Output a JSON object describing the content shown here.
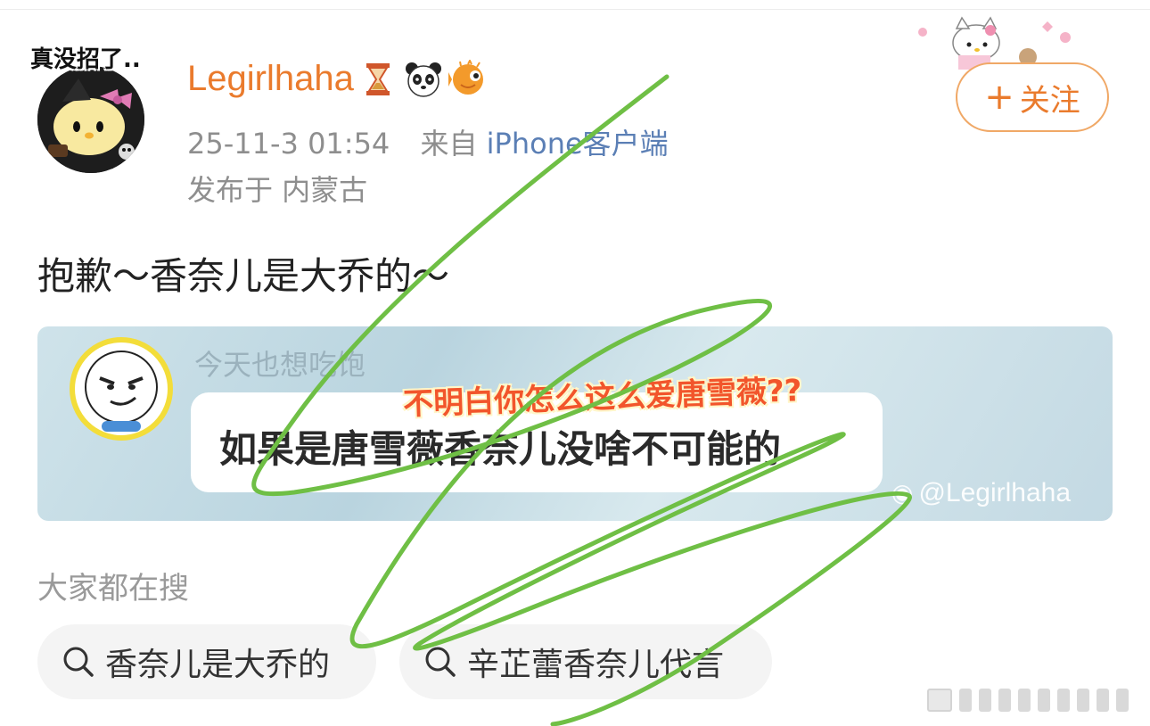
{
  "user": {
    "avatar_caption": "真没招了..",
    "username": "Legirlhaha",
    "badges": [
      "hourglass-icon",
      "panda-icon",
      "pufferfish-icon"
    ]
  },
  "post_meta": {
    "time": "25-11-3 01:54",
    "source_prefix": "来自",
    "source_client": "iPhone客户端",
    "location": "发布于 内蒙古"
  },
  "follow_button": {
    "plus": "+",
    "label": "关注"
  },
  "post": {
    "text": "抱歉～香奈儿是大乔的～"
  },
  "quoted_image": {
    "commenter_name": "今天也想吃饱",
    "comment": "如果是唐雪薇香奈儿没啥不可能的",
    "overlay_caption": "不明白你怎么这么爱唐雪薇??",
    "watermark": "@Legirlhaha"
  },
  "search": {
    "heading": "大家都在搜",
    "chips": [
      "香奈儿是大乔的",
      "辛芷蕾香奈儿代言"
    ]
  },
  "colors": {
    "accent_orange": "#ea7b2d",
    "client_blue": "#5b7fb5",
    "scribble_green": "#6fbf45",
    "overlay_red": "#f2552b"
  }
}
